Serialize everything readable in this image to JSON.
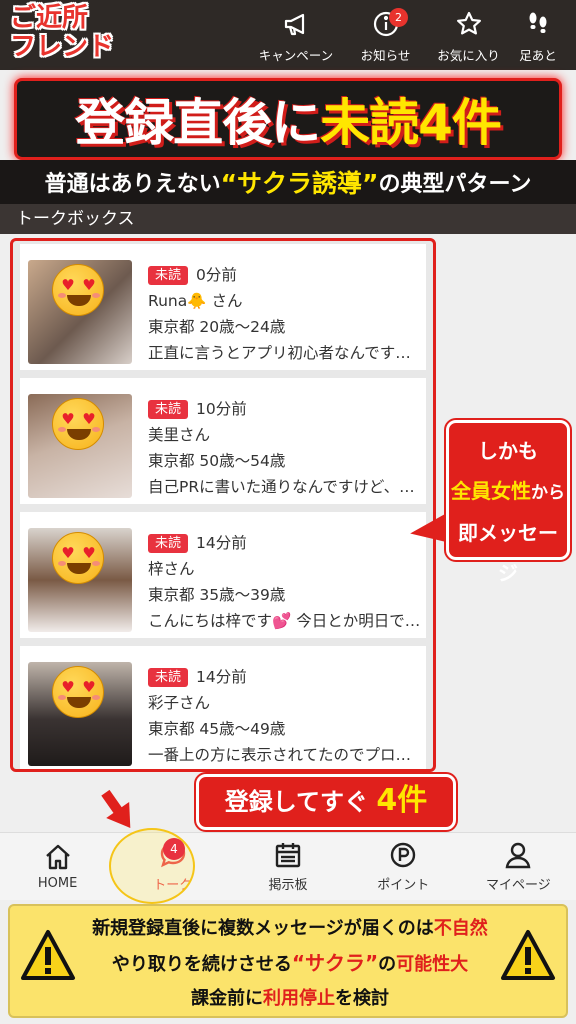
{
  "header": {
    "logo_line1": "ご近所",
    "logo_line2": "フレンド",
    "nav": [
      {
        "label": "キャンペーン",
        "icon": "megaphone-icon"
      },
      {
        "label": "お知らせ",
        "icon": "info-icon",
        "badge": "2"
      },
      {
        "label": "お気に入り",
        "icon": "star-icon"
      },
      {
        "label": "足あと",
        "icon": "footprints-icon"
      }
    ]
  },
  "banner": {
    "text_a": "登録直後に",
    "text_b": "未読4件",
    "sub_a": "普通はありえない",
    "sub_b": "“サクラ誘導”",
    "sub_c": "の典型パターン"
  },
  "section_title": "トークボックス",
  "messages": [
    {
      "badge": "未読",
      "time": "0分前",
      "name": "Runa🐥 さん",
      "profile": "東京都 20歳〜24歳",
      "preview": "正直に言うとアプリ初心者なんです…"
    },
    {
      "badge": "未読",
      "time": "10分前",
      "name": "美里さん",
      "profile": "東京都 50歳〜54歳",
      "preview": "自己PRに書いた通りなんですけど、…"
    },
    {
      "badge": "未読",
      "time": "14分前",
      "name": "梓さん",
      "profile": "東京都 35歳〜39歳",
      "preview": "こんにちは梓です💕 今日とか明日で…"
    },
    {
      "badge": "未読",
      "time": "14分前",
      "name": "彩子さん",
      "profile": "東京都 45歳〜49歳",
      "preview": "一番上の方に表示されてたのでプロ…"
    }
  ],
  "callout": {
    "line1": "しかも",
    "line2_hl": "全員女性",
    "line2_rest": "から",
    "line3": "即メッセージ"
  },
  "bottom_callout": {
    "text": "登録してすぐ",
    "count": "4件"
  },
  "bottom_nav": [
    {
      "label": "HOME",
      "icon": "home-icon"
    },
    {
      "label": "トーク",
      "icon": "chat-icon",
      "badge": "4"
    },
    {
      "label": "掲示板",
      "icon": "calendar-board-icon"
    },
    {
      "label": "ポイント",
      "icon": "point-icon"
    },
    {
      "label": "マイページ",
      "icon": "person-icon"
    }
  ],
  "warning": {
    "line1_a": "新規登録直後に複数メッセージが届くのは",
    "line1_b": "不自然",
    "line2_a": "やり取りを続けさせる",
    "line2_b": "“サクラ”",
    "line2_c": "の",
    "line2_d": "可能性大",
    "line3_a": "課金前に",
    "line3_b": "利用停止",
    "line3_c": "を検討"
  },
  "colors": {
    "accent_red": "#e0201c",
    "highlight_yellow": "#ffe600",
    "header_bg": "#2e2926",
    "warning_bg": "#fbe36b"
  }
}
